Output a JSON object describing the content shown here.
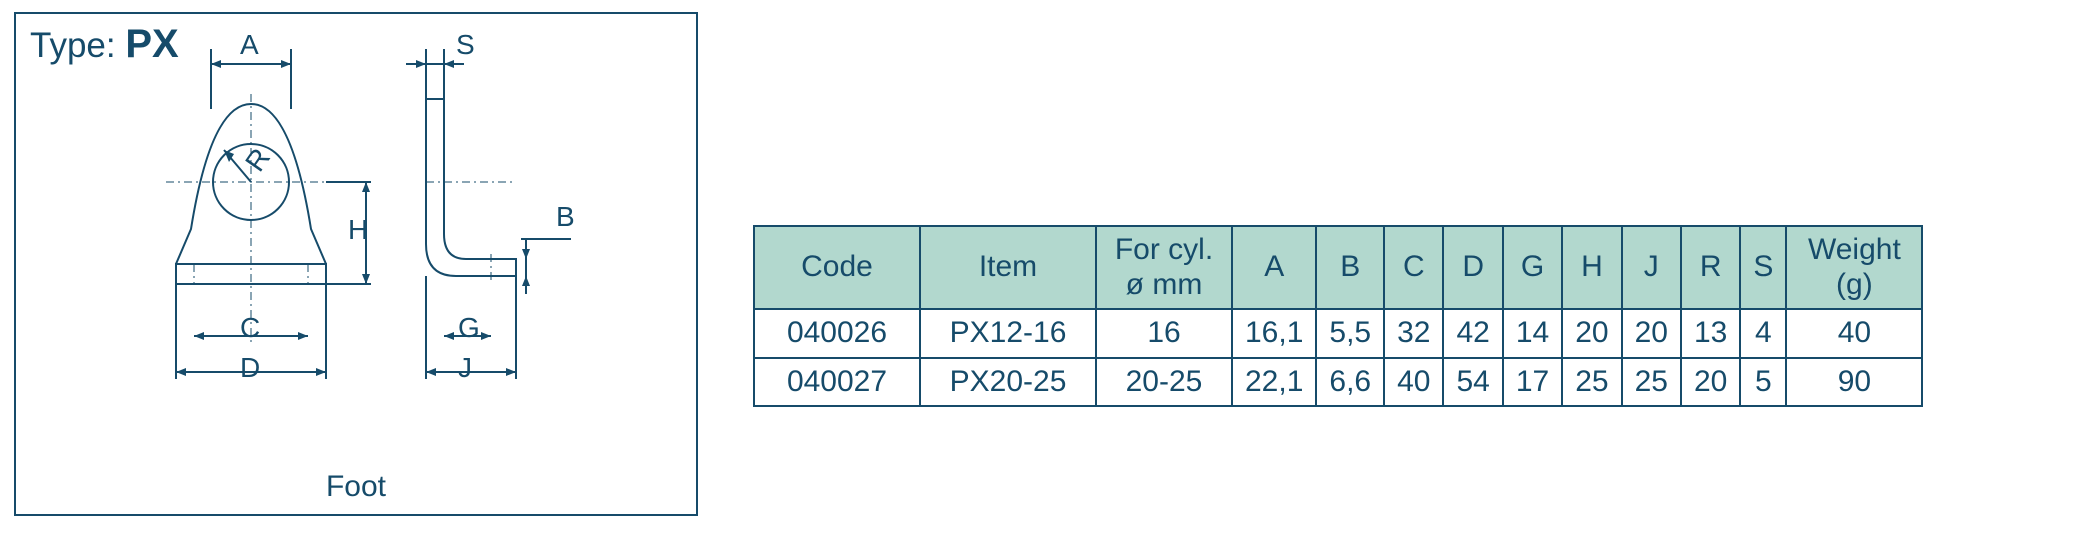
{
  "type_label_prefix": "Type: ",
  "type_label_value": "PX",
  "diagram_caption": "Foot",
  "dims": {
    "A": "A",
    "B": "B",
    "C": "C",
    "D": "D",
    "G": "G",
    "H": "H",
    "J": "J",
    "R": "R",
    "S": "S"
  },
  "table": {
    "headers": {
      "code": "Code",
      "item": "Item",
      "cyl_l1": "For cyl.",
      "cyl_l2": "ø mm",
      "A": "A",
      "B": "B",
      "C": "C",
      "D": "D",
      "G": "G",
      "H": "H",
      "J": "J",
      "R": "R",
      "S": "S",
      "weight_l1": "Weight",
      "weight_l2": "(g)"
    },
    "rows": [
      {
        "code": "040026",
        "item": "PX12-16",
        "cyl": "16",
        "A": "16,1",
        "B": "5,5",
        "C": "32",
        "D": "42",
        "G": "14",
        "H": "20",
        "J": "20",
        "R": "13",
        "S": "4",
        "weight": "40"
      },
      {
        "code": "040027",
        "item": "PX20-25",
        "cyl": "20-25",
        "A": "22,1",
        "B": "6,6",
        "C": "40",
        "D": "54",
        "G": "17",
        "H": "25",
        "J": "25",
        "R": "20",
        "S": "5",
        "weight": "90"
      }
    ]
  }
}
